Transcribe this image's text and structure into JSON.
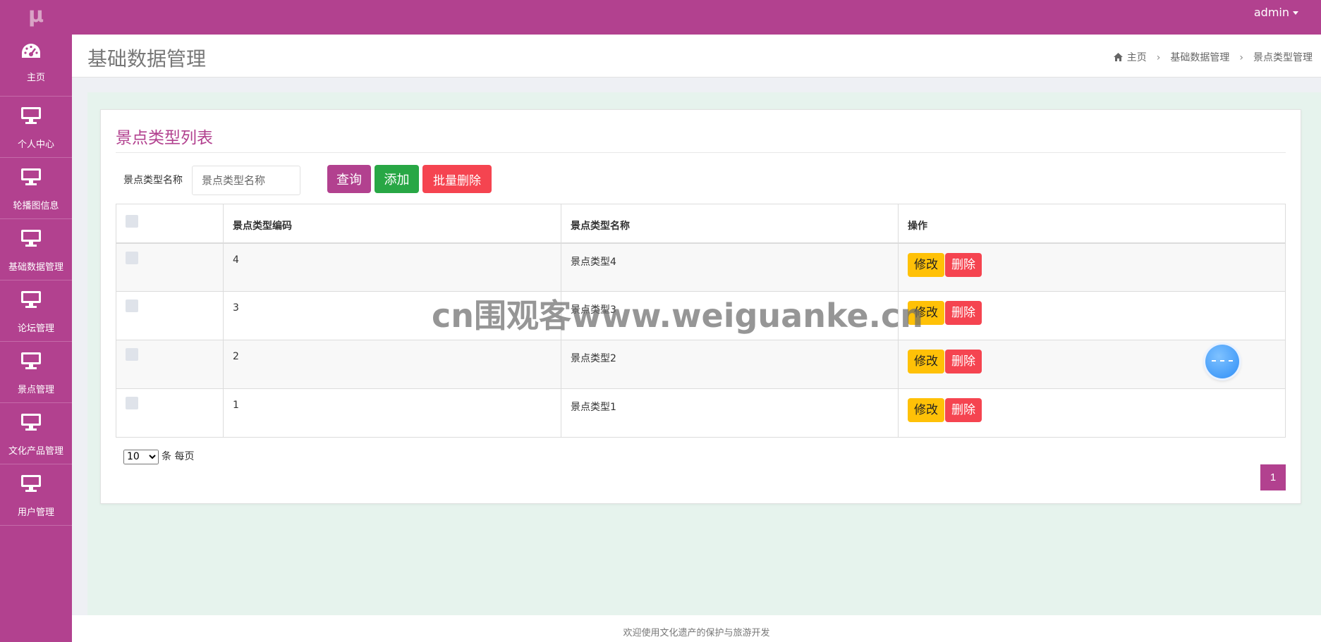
{
  "app": {
    "logo": "μ",
    "user": "admin"
  },
  "sidebar": {
    "items": [
      {
        "label": "主页",
        "icon": "dashboard-icon"
      },
      {
        "label": "个人中心",
        "icon": "monitor-icon"
      },
      {
        "label": "轮播图信息",
        "icon": "monitor-icon"
      },
      {
        "label": "基础数据管理",
        "icon": "monitor-icon"
      },
      {
        "label": "论坛管理",
        "icon": "monitor-icon"
      },
      {
        "label": "景点管理",
        "icon": "monitor-icon"
      },
      {
        "label": "文化产品管理",
        "icon": "monitor-icon"
      },
      {
        "label": "用户管理",
        "icon": "monitor-icon"
      }
    ]
  },
  "header": {
    "title": "基础数据管理",
    "breadcrumb": {
      "home": "主页",
      "level1": "基础数据管理",
      "level2": "景点类型管理"
    }
  },
  "card": {
    "title": "景点类型列表"
  },
  "search": {
    "label": "景点类型名称",
    "placeholder": "景点类型名称",
    "value": ""
  },
  "buttons": {
    "query": "查询",
    "add": "添加",
    "batch_delete": "批量删除"
  },
  "table": {
    "headers": {
      "code": "景点类型编码",
      "name": "景点类型名称",
      "ops": "操作"
    },
    "rows": [
      {
        "code": "4",
        "name": "景点类型4",
        "edit": "修改",
        "delete": "删除"
      },
      {
        "code": "3",
        "name": "景点类型3",
        "edit": "修改",
        "delete": "删除"
      },
      {
        "code": "2",
        "name": "景点类型2",
        "edit": "修改",
        "delete": "删除"
      },
      {
        "code": "1",
        "name": "景点类型1",
        "edit": "修改",
        "delete": "删除"
      }
    ]
  },
  "pagination": {
    "page_size": "10",
    "page_size_options": [
      "10"
    ],
    "per_page_text": "条 每页",
    "current_page": "1"
  },
  "watermark": "cn围观客www.weiguanke.cn",
  "footer": {
    "text": "欢迎使用文化遗产的保护与旅游开发"
  },
  "colors": {
    "brand": "#b2418f",
    "success": "#28a745",
    "danger": "#f54450",
    "warning": "#ffc107"
  }
}
